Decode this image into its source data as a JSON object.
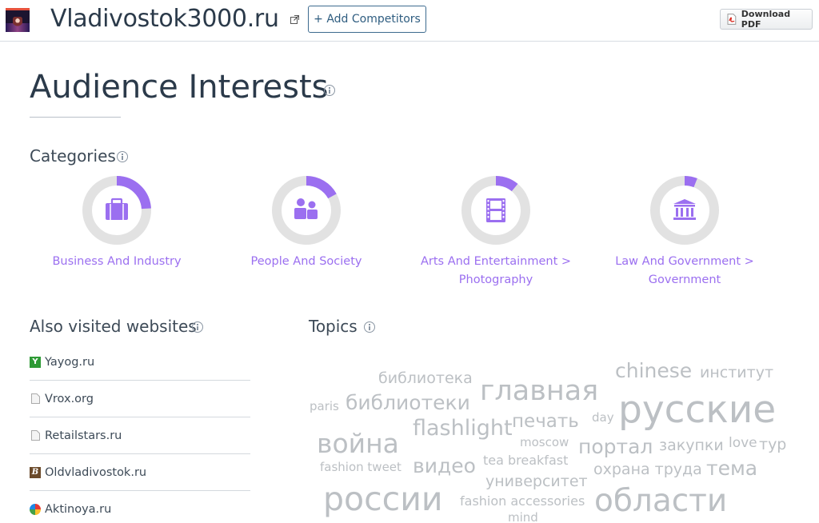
{
  "header": {
    "site_title": "Vladivostok3000.ru",
    "add_competitors_label": "+ Add Competitors",
    "download_pdf_label": "Download PDF",
    "favicon_icon": "site-favicon-icon",
    "external_link_icon": "external-link-icon"
  },
  "page": {
    "heading": "Audience Interests"
  },
  "categories": {
    "title": "Categories",
    "accent_color": "#9b6ff0",
    "track_color": "#e2e2e2",
    "items": [
      {
        "label": "Business And Industry",
        "icon": "briefcase-icon",
        "share": 0.24
      },
      {
        "label": "People And Society",
        "icon": "people-icon",
        "share": 0.17
      },
      {
        "label": "Arts And Entertainment > Photography",
        "icon": "film-icon",
        "share": 0.11
      },
      {
        "label": "Law And Government > Government",
        "icon": "government-building-icon",
        "share": 0.06
      }
    ]
  },
  "also_visited": {
    "title": "Also visited websites",
    "sites": [
      {
        "name": "Yayog.ru",
        "icon": "yayog-favicon"
      },
      {
        "name": "Vrox.org",
        "icon": "page-icon"
      },
      {
        "name": "Retailstars.ru",
        "icon": "page-icon"
      },
      {
        "name": "Oldvladivostok.ru",
        "icon": "oldvladivostok-favicon"
      },
      {
        "name": "Aktinoya.ru",
        "icon": "aktinoya-favicon"
      }
    ]
  },
  "topics": {
    "title": "Topics",
    "words": [
      "библиотека",
      "chinese",
      "институт",
      "paris",
      "библиотеки",
      "главная",
      "flashlight",
      "печать",
      "day",
      "русские",
      "война",
      "moscow",
      "портал",
      "закупки",
      "love",
      "тур",
      "fashion tweet",
      "видео",
      "tea breakfast",
      "охрана труда",
      "тема",
      "университет",
      "россии",
      "fashion accessories",
      "области",
      "mind"
    ]
  }
}
